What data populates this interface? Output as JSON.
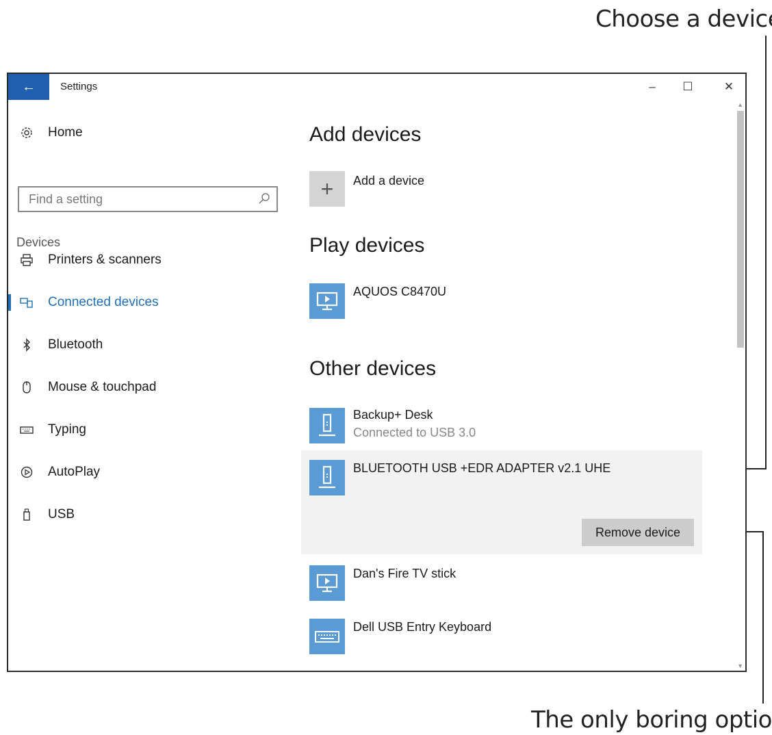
{
  "callouts": {
    "top": "Choose a device",
    "bottom": "The only boring option"
  },
  "window": {
    "title": "Settings",
    "back_icon": "back-arrow-icon",
    "controls": {
      "minimize": "–",
      "maximize": "☐",
      "close": "✕"
    }
  },
  "sidebar": {
    "home_label": "Home",
    "search_placeholder": "Find a setting",
    "section_label": "Devices",
    "items": [
      {
        "label": "Printers & scanners",
        "icon": "printer-icon"
      },
      {
        "label": "Connected devices",
        "icon": "connected-devices-icon",
        "active": true
      },
      {
        "label": "Bluetooth",
        "icon": "bluetooth-icon"
      },
      {
        "label": "Mouse & touchpad",
        "icon": "mouse-icon"
      },
      {
        "label": "Typing",
        "icon": "keyboard-icon"
      },
      {
        "label": "AutoPlay",
        "icon": "autoplay-icon"
      },
      {
        "label": "USB",
        "icon": "usb-icon"
      }
    ]
  },
  "content": {
    "add_heading": "Add devices",
    "add_device_label": "Add a device",
    "play_heading": "Play devices",
    "play_devices": [
      {
        "name": "AQUOS C8470U",
        "icon": "display-icon"
      }
    ],
    "other_heading": "Other devices",
    "other_devices": [
      {
        "name": "Backup+  Desk",
        "status": "Connected to USB 3.0",
        "icon": "usb-drive-icon"
      },
      {
        "name": "BLUETOOTH USB +EDR ADAPTER v2.1 UHE",
        "icon": "usb-drive-icon",
        "selected": true
      },
      {
        "name": "Dan's Fire TV stick",
        "icon": "display-icon"
      },
      {
        "name": "Dell USB Entry Keyboard",
        "icon": "keyboard-icon"
      }
    ],
    "remove_button": "Remove device"
  },
  "colors": {
    "accent": "#1f5fae",
    "device_tile": "#5b9bd5",
    "selected_bg": "#f2f2f2"
  }
}
